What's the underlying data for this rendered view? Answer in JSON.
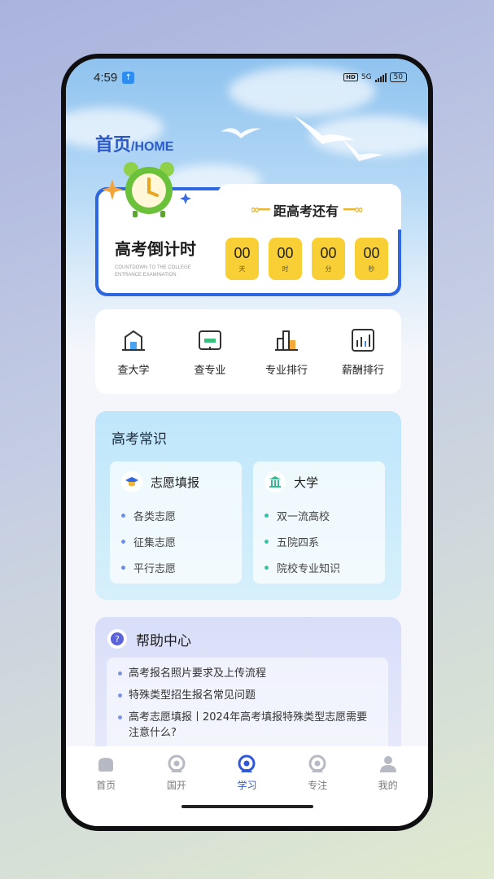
{
  "status": {
    "time": "4:59",
    "network": "5G",
    "battery": "50"
  },
  "header": {
    "title_zh": "首页",
    "title_en": "/HOME"
  },
  "countdown": {
    "heading": "距高考还有",
    "label": "高考倒计时",
    "label_en": "COUNTDOWN TO THE COLLEGE ENTRANCE EXAMINATION",
    "units": [
      {
        "value": "00",
        "unit": "天"
      },
      {
        "value": "00",
        "unit": "时"
      },
      {
        "value": "00",
        "unit": "分"
      },
      {
        "value": "00",
        "unit": "秒"
      }
    ]
  },
  "quick_links": [
    {
      "label": "查大学",
      "icon": "university-icon"
    },
    {
      "label": "查专业",
      "icon": "book-icon"
    },
    {
      "label": "专业排行",
      "icon": "bar-chart-icon"
    },
    {
      "label": "薪酬排行",
      "icon": "salary-chart-icon"
    }
  ],
  "knowledge": {
    "title": "高考常识",
    "cards": [
      {
        "title": "志愿填报",
        "icon": "graduation-cap-icon",
        "items": [
          "各类志愿",
          "征集志愿",
          "平行志愿"
        ],
        "dot_color": "#6b8ee8"
      },
      {
        "title": "大学",
        "icon": "institution-icon",
        "items": [
          "双一流高校",
          "五院四系",
          "院校专业知识"
        ],
        "dot_color": "#35c2a8"
      }
    ]
  },
  "help": {
    "title": "帮助中心",
    "items": [
      "高考报名照片要求及上传流程",
      "特殊类型招生报名常见问题",
      "高考志愿填报丨2024年高考填报特殊类型志愿需要注意什么?"
    ]
  },
  "tabs": [
    {
      "label": "首页",
      "active": false
    },
    {
      "label": "国开",
      "active": false
    },
    {
      "label": "学习",
      "active": true
    },
    {
      "label": "专注",
      "active": false
    },
    {
      "label": "我的",
      "active": false
    }
  ],
  "colors": {
    "accent": "#2f67e0",
    "yellow": "#f8cf35"
  }
}
